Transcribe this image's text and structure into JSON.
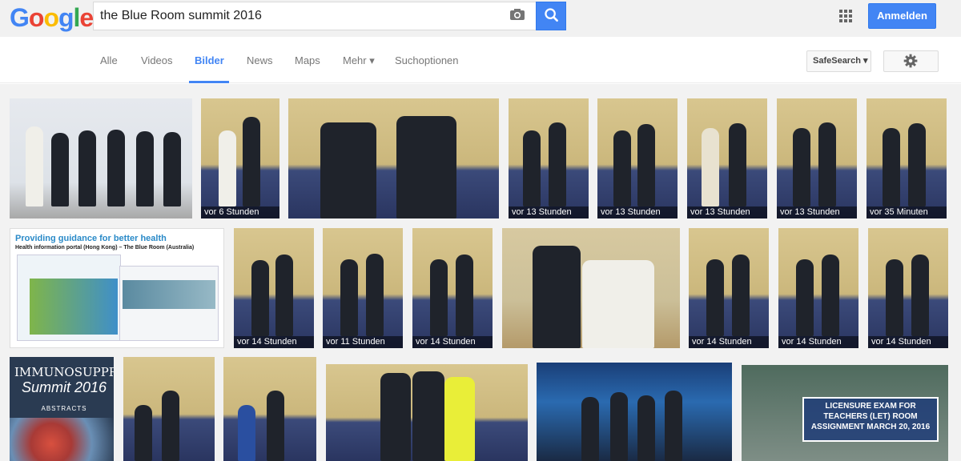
{
  "logo": {
    "letters": [
      "G",
      "o",
      "o",
      "g",
      "l",
      "e"
    ],
    "colors": [
      "#4285f4",
      "#ea4335",
      "#fbbc05",
      "#4285f4",
      "#34a853",
      "#ea4335"
    ]
  },
  "search": {
    "value": "the Blue Room summit 2016",
    "placeholder": ""
  },
  "header": {
    "signin_label": "Anmelden"
  },
  "tabs": [
    {
      "label": "Alle"
    },
    {
      "label": "Videos"
    },
    {
      "label": "Bilder",
      "active": true
    },
    {
      "label": "News"
    },
    {
      "label": "Maps"
    },
    {
      "label": "Mehr ▾"
    },
    {
      "label": "Suchoptionen"
    }
  ],
  "safesearch_label": "SafeSearch ▾",
  "accent_color": "#4285f4",
  "results": {
    "row1": [
      {
        "label": ""
      },
      {
        "label": "vor 6 Stunden"
      },
      {
        "label": ""
      },
      {
        "label": "vor 13 Stunden"
      },
      {
        "label": "vor 13 Stunden"
      },
      {
        "label": "vor 13 Stunden"
      },
      {
        "label": "vor 13 Stunden"
      },
      {
        "label": "vor 35 Minuten"
      }
    ],
    "row2": [
      {
        "label": "",
        "title": "Providing guidance for better health",
        "subtitle": "Health information portal (Hong Kong) – The Blue Room (Australia)"
      },
      {
        "label": "vor 14 Stunden"
      },
      {
        "label": "vor 11 Stunden"
      },
      {
        "label": "vor 14 Stunden"
      },
      {
        "label": ""
      },
      {
        "label": "vor 14 Stunden"
      },
      {
        "label": "vor 14 Stunden"
      },
      {
        "label": "vor 14 Stunden"
      }
    ],
    "row3": [
      {
        "title": "IMMUNOSUPPRESSION",
        "subtitle": "Summit 2016",
        "extra": "ABSTRACTS"
      },
      {
        "label": ""
      },
      {
        "label": ""
      },
      {
        "label": ""
      },
      {
        "label": ""
      },
      {
        "banner": "LICENSURE EXAM FOR TEACHERS (LET) ROOM ASSIGNMENT MARCH 20, 2016"
      }
    ]
  }
}
